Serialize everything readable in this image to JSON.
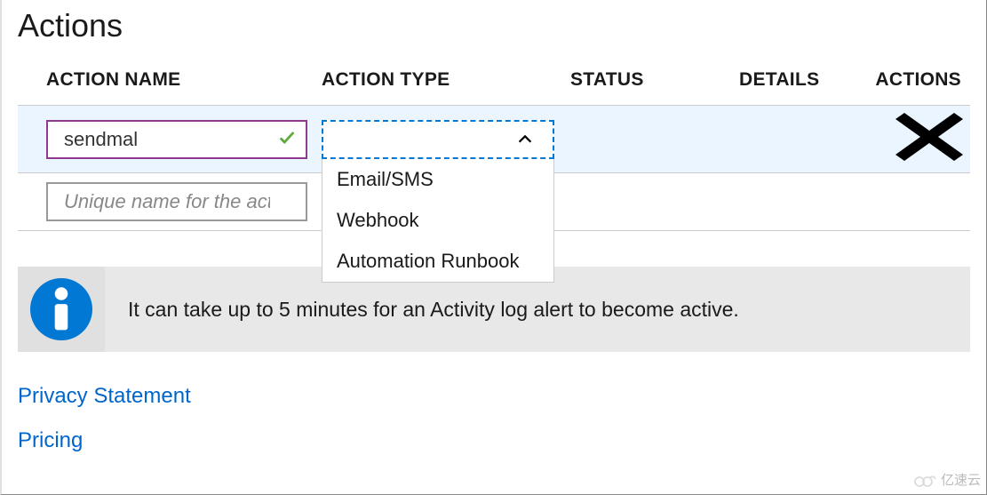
{
  "title": "Actions",
  "columns": {
    "name": "ACTION NAME",
    "type": "ACTION TYPE",
    "status": "STATUS",
    "details": "DETAILS",
    "actions": "ACTIONS"
  },
  "rows": [
    {
      "name_value": "sendmal",
      "valid": true,
      "type_selected": "",
      "dropdown_open": true
    }
  ],
  "new_row": {
    "placeholder": "Unique name for the action"
  },
  "dropdown_options": [
    "Email/SMS",
    "Webhook",
    "Automation Runbook"
  ],
  "info_message": "It can take up to 5 minutes for an Activity log alert to become active.",
  "links": {
    "privacy": "Privacy Statement",
    "pricing": "Pricing"
  },
  "watermark": "亿速云"
}
